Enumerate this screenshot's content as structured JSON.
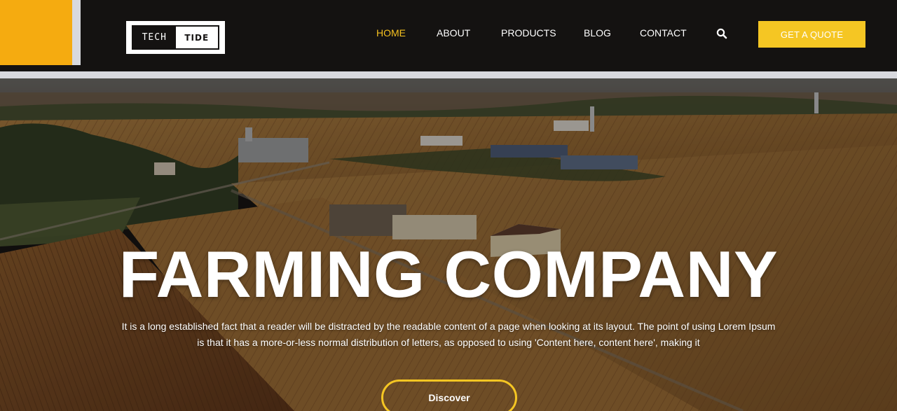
{
  "brand": {
    "logo_left": "TECH",
    "logo_right": "TIDE",
    "accent_color": "#f5ab10",
    "button_color": "#f5c623"
  },
  "nav": {
    "items": [
      {
        "label": "HOME",
        "active": true
      },
      {
        "label": "ABOUT",
        "active": false
      },
      {
        "label": "PRODUCTS",
        "active": false
      },
      {
        "label": "BLOG",
        "active": false
      },
      {
        "label": "CONTACT",
        "active": false
      }
    ],
    "search_icon": "search-icon",
    "cta_label": "GET A QUOTE"
  },
  "hero": {
    "title": "FARMING COMPANY",
    "text": "It is a long established fact that a reader will be distracted by the readable content of a page when looking at its layout. The point of using Lorem Ipsum is that it has a more-or-less normal distribution of letters, as opposed to using 'Content here, content here', making it",
    "button_label": "Discover"
  }
}
